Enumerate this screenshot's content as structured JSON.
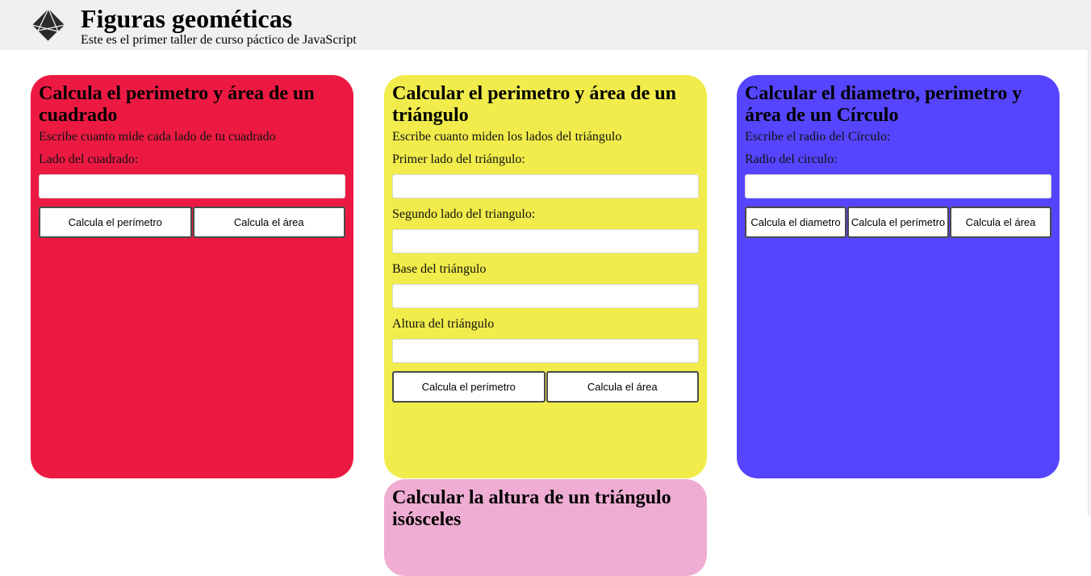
{
  "header": {
    "title": "Figuras geométicas",
    "subtitle": "Este es el primer taller de curso páctico de JavaScript",
    "logo": "geometric-diamond-logo",
    "background": "#f1f0f0"
  },
  "cards": {
    "square": {
      "title": "Calcula el perimetro y área de un cuadrado",
      "description": "Escribe cuanto mide cada lado de tu cuadrado",
      "side_label": "Lado del cuadrado:",
      "side_value": "",
      "perimeter_button": "Calcula el perímetro",
      "area_button": "Calcula el área",
      "color": "#ec1a42"
    },
    "triangle": {
      "title": "Calcular el perimetro y área de un triángulo",
      "description": "Escribe cuanto miden los lados del triángulo",
      "side1_label": "Primer lado del triángulo:",
      "side1_value": "",
      "side2_label": "Segundo lado del triangulo:",
      "side2_value": "",
      "base_label": "Base del triángulo",
      "base_value": "",
      "height_label": "Altura del triángulo",
      "height_value": "",
      "perimeter_button": "Calcula el perímetro",
      "area_button": "Calcula el área",
      "color": "#f1ec4b"
    },
    "circle": {
      "title": "Calcular el diametro, perimetro y área de un Círculo",
      "description": "Escribe el radio del Círculo:",
      "radius_label": "Radio del circulo:",
      "radius_value": "",
      "diameter_button": "Calcula el diametro",
      "perimeter_button": "Calcula el perímetro",
      "area_button": "Calcula el área",
      "color": "#5545fe"
    },
    "triangle_height": {
      "title": "Calcular la altura de un triángulo isósceles",
      "color": "#efadd3"
    }
  }
}
